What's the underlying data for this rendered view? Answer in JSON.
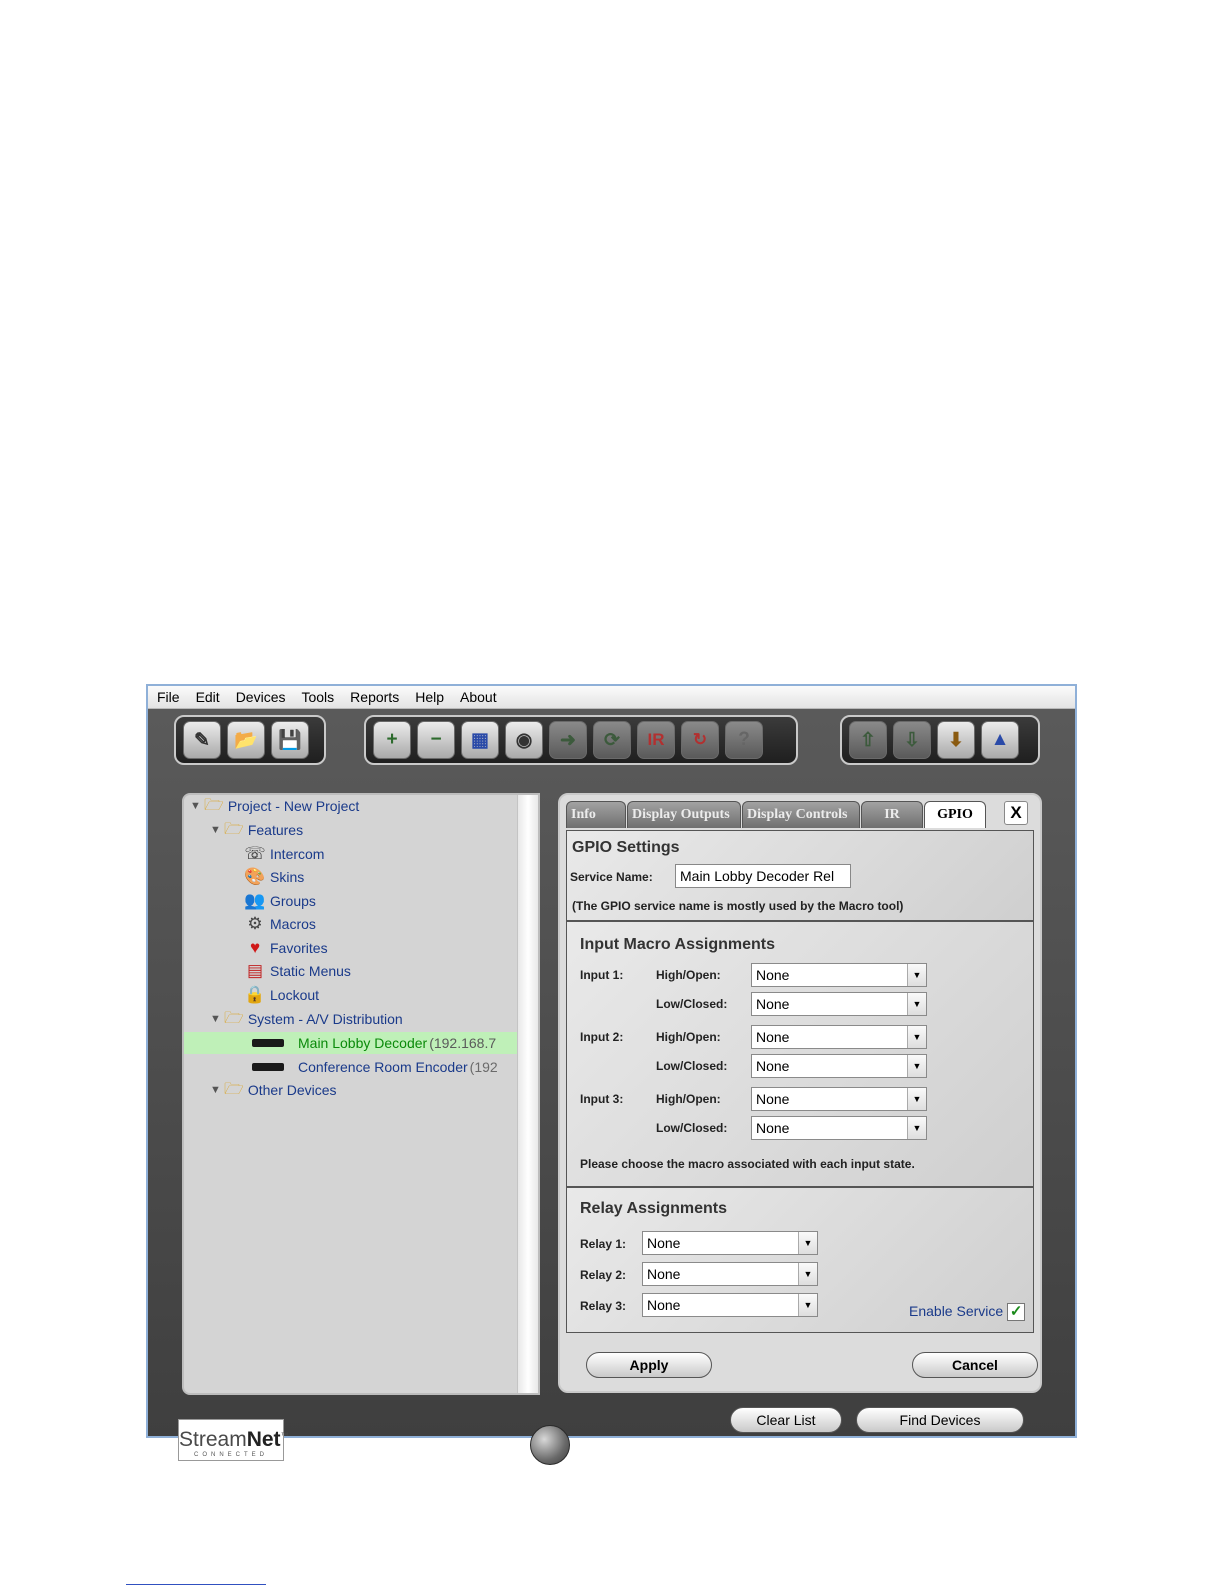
{
  "menu": [
    "File",
    "Edit",
    "Devices",
    "Tools",
    "Reports",
    "Help",
    "About"
  ],
  "toolbar": {
    "group1": [
      {
        "icon": "new-project-icon",
        "glyph": "✎"
      },
      {
        "icon": "open-project-icon",
        "glyph": "📂"
      },
      {
        "icon": "save-icon",
        "glyph": "💾"
      }
    ],
    "group2": [
      {
        "icon": "add-device-icon",
        "glyph": "+"
      },
      {
        "icon": "remove-device-icon",
        "glyph": "−"
      },
      {
        "icon": "devices-icon",
        "glyph": "▦"
      },
      {
        "icon": "fingerprint-icon",
        "glyph": "◉"
      },
      {
        "icon": "arrow-forward-icon",
        "glyph": "➜"
      },
      {
        "icon": "cycle-icon",
        "glyph": "⟳"
      },
      {
        "icon": "ir-icon",
        "glyph": "IR"
      },
      {
        "icon": "refresh-icon",
        "glyph": "↻"
      },
      {
        "icon": "help-icon",
        "glyph": "?"
      }
    ],
    "group3": [
      {
        "icon": "upload-icon",
        "glyph": "⇧"
      },
      {
        "icon": "download-icon",
        "glyph": "⇩"
      },
      {
        "icon": "firmware-icon",
        "glyph": "⬇"
      },
      {
        "icon": "wizard-icon",
        "glyph": "▲"
      }
    ]
  },
  "tree": {
    "project": "Project - New Project",
    "features_label": "Features",
    "features": [
      "Intercom",
      "Skins",
      "Groups",
      "Macros",
      "Favorites",
      "Static Menus",
      "Lockout"
    ],
    "feature_icons": [
      "intercom-icon",
      "skins-icon",
      "groups-icon",
      "macros-icon",
      "favorites-icon",
      "static-menus-icon",
      "lockout-icon"
    ],
    "system_label": "System - A/V Distribution",
    "devices": [
      {
        "name": "Main Lobby Decoder",
        "ip": "(192.168.7"
      },
      {
        "name": "Conference Room Encoder",
        "ip": "(192"
      }
    ],
    "other_label": "Other Devices"
  },
  "tabs": [
    "Info",
    "Display Outputs",
    "Display Controls",
    "IR",
    "GPIO"
  ],
  "close_label": "X",
  "gpio": {
    "title": "GPIO Settings",
    "service_name_label": "Service Name:",
    "service_name_value": "Main Lobby Decoder Rel",
    "note": "(The GPIO service name is mostly used by the Macro tool)"
  },
  "input_macros": {
    "title": "Input Macro Assignments",
    "high_label": "High/Open:",
    "low_label": "Low/Closed:",
    "inputs": [
      {
        "label": "Input 1:",
        "high": "None",
        "low": "None"
      },
      {
        "label": "Input 2:",
        "high": "None",
        "low": "None"
      },
      {
        "label": "Input 3:",
        "high": "None",
        "low": "None"
      }
    ],
    "note": "Please choose the macro associated with each input state."
  },
  "relays": {
    "title": "Relay Assignments",
    "items": [
      {
        "label": "Relay 1:",
        "value": "None"
      },
      {
        "label": "Relay 2:",
        "value": "None"
      },
      {
        "label": "Relay 3:",
        "value": "None"
      }
    ],
    "enable_label": "Enable Service",
    "enable_checked": "✓"
  },
  "buttons": {
    "apply": "Apply",
    "cancel": "Cancel",
    "clear": "Clear List",
    "find": "Find Devices"
  },
  "logo": {
    "stream": "Stream",
    "net": "Net",
    "tm": "™",
    "sub": "CONNECTED"
  }
}
